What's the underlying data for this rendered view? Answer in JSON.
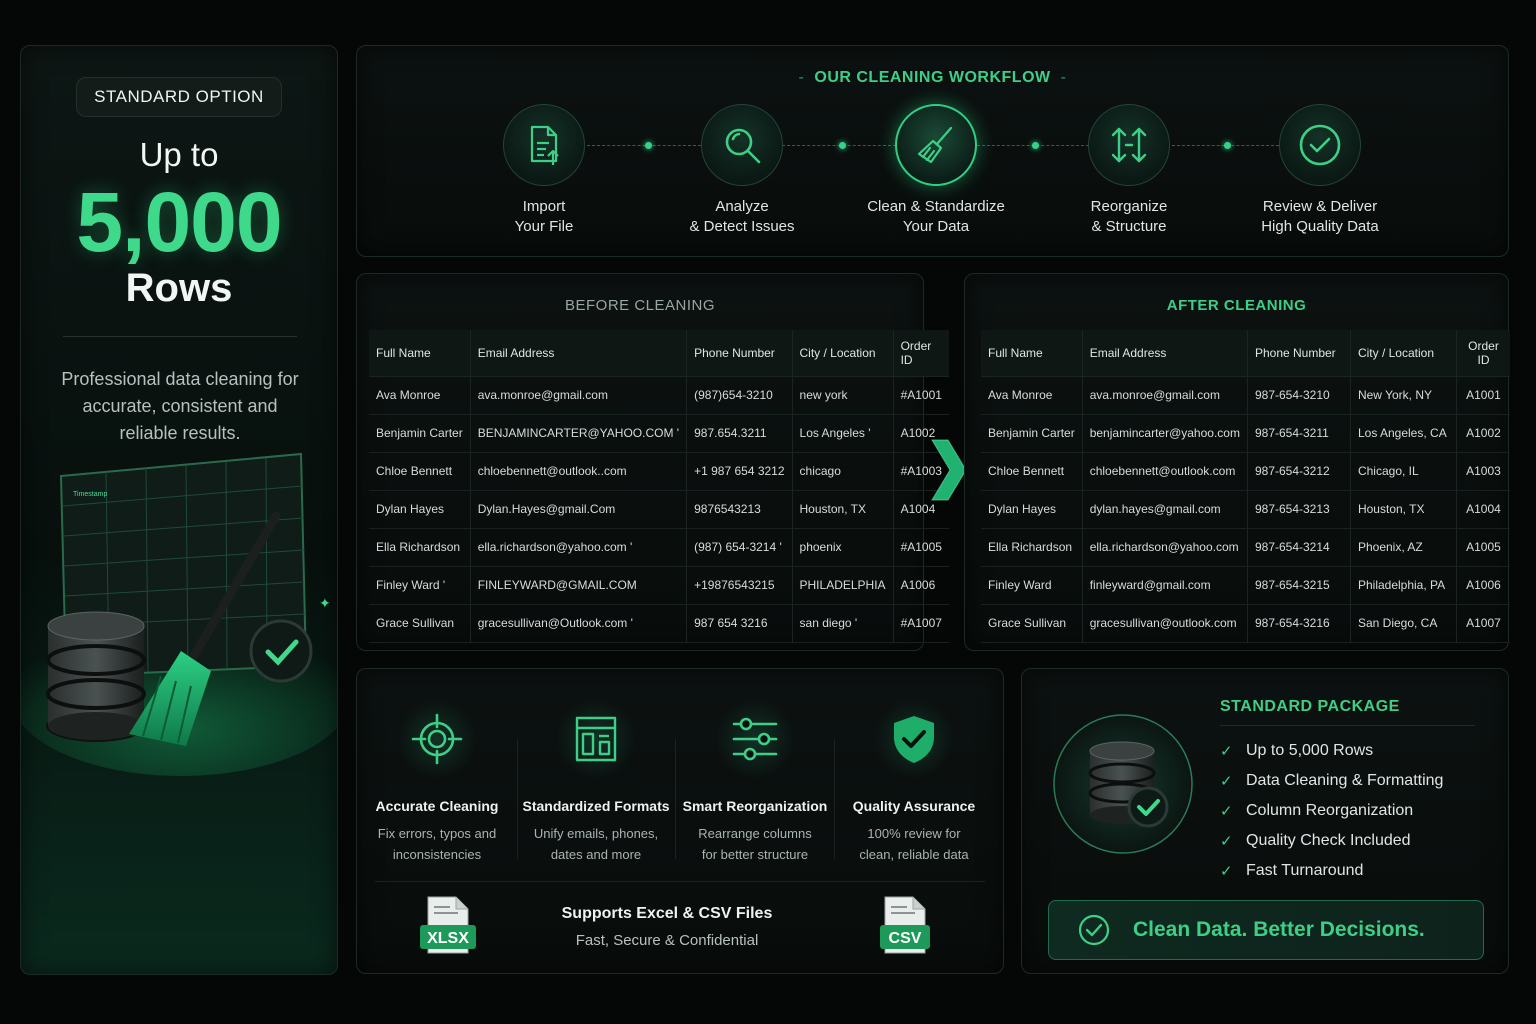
{
  "left": {
    "badge": "STANDARD OPTION",
    "up_to": "Up to",
    "big_number": "5,000",
    "rows_label": "Rows",
    "description": "Professional data cleaning for accurate, consistent and reliable results."
  },
  "workflow": {
    "title": "OUR CLEANING WORKFLOW",
    "steps": [
      {
        "line1": "Import",
        "line2": "Your File",
        "icon": "file-upload-icon"
      },
      {
        "line1": "Analyze",
        "line2": "& Detect Issues",
        "icon": "magnifier-icon"
      },
      {
        "line1": "Clean & Standardize",
        "line2": "Your Data",
        "icon": "broom-icon"
      },
      {
        "line1": "Reorganize",
        "line2": "& Structure",
        "icon": "sort-arrows-icon"
      },
      {
        "line1": "Review & Deliver",
        "line2": "High Quality Data",
        "icon": "check-circle-icon"
      }
    ]
  },
  "before": {
    "title": "BEFORE CLEANING",
    "columns": [
      "Full Name",
      "Email Address",
      "Phone Number",
      "City / Location",
      "Order ID"
    ],
    "rows": [
      [
        "Ava Monroe",
        "ava.monroe@gmail.com",
        "(987)654-3210",
        "new york",
        "#A1001"
      ],
      [
        " Benjamin  Carter",
        "BENJAMINCARTER@YAHOO.COM '",
        " 987.654.3211",
        "Los Angeles '",
        " A1002"
      ],
      [
        "Chloe Bennett",
        "chloebennett@outlook..com",
        "+1 987 654 3212",
        "chicago",
        "#A1003"
      ],
      [
        "Dylan Hayes",
        "Dylan.Hayes@gmail.Com",
        " 9876543213",
        "Houston, TX",
        " A1004"
      ],
      [
        "Ella Richardson",
        "ella.richardson@yahoo.com '",
        "(987) 654-3214 '",
        "phoenix",
        "#A1005"
      ],
      [
        " Finley Ward '",
        "FINLEYWARD@GMAIL.COM",
        "+19876543215",
        "PHILADELPHIA",
        " A1006"
      ],
      [
        "Grace Sullivan",
        "gracesullivan@Outlook.com '",
        " 987 654 3216",
        "san diego '",
        "#A1007"
      ]
    ]
  },
  "after": {
    "title": "AFTER CLEANING",
    "columns": [
      "Full Name",
      "Email Address",
      "Phone Number",
      "City / Location",
      "Order ID"
    ],
    "rows": [
      [
        "Ava Monroe",
        "ava.monroe@gmail.com",
        "987-654-3210",
        "New York, NY",
        "A1001"
      ],
      [
        "Benjamin Carter",
        "benjamincarter@yahoo.com",
        "987-654-3211",
        "Los Angeles, CA",
        "A1002"
      ],
      [
        "Chloe Bennett",
        "chloebennett@outlook.com",
        "987-654-3212",
        "Chicago, IL",
        "A1003"
      ],
      [
        "Dylan Hayes",
        "dylan.hayes@gmail.com",
        "987-654-3213",
        "Houston, TX",
        "A1004"
      ],
      [
        "Ella Richardson",
        "ella.richardson@yahoo.com",
        "987-654-3214",
        "Phoenix, AZ",
        "A1005"
      ],
      [
        "Finley Ward",
        "finleyward@gmail.com",
        "987-654-3215",
        "Philadelphia, PA",
        "A1006"
      ],
      [
        "Grace Sullivan",
        "gracesullivan@outlook.com",
        "987-654-3216",
        "San Diego, CA",
        "A1007"
      ]
    ]
  },
  "features": {
    "items": [
      {
        "title": "Accurate Cleaning",
        "line1": "Fix errors, typos and",
        "line2": "inconsistencies",
        "icon": "target-icon"
      },
      {
        "title": "Standardized Formats",
        "line1": "Unify emails, phones,",
        "line2": "dates and more",
        "icon": "layout-icon"
      },
      {
        "title": "Smart Reorganization",
        "line1": "Rearrange columns",
        "line2": "for better structure",
        "icon": "sliders-icon"
      },
      {
        "title": "Quality Assurance",
        "line1": "100% review for",
        "line2": "clean, reliable data",
        "icon": "shield-check-icon"
      }
    ],
    "supports_title": "Supports Excel & CSV Files",
    "supports_sub": "Fast, Secure & Confidential",
    "xlsx_label": "XLSX",
    "csv_label": "CSV"
  },
  "package": {
    "title": "STANDARD PACKAGE",
    "items": [
      "Up to 5,000 Rows",
      "Data Cleaning & Formatting",
      "Column Reorganization",
      "Quality Check Included",
      "Fast Turnaround"
    ],
    "tagline": "Clean Data. Better Decisions."
  },
  "colors": {
    "accent": "#3ecf86",
    "background": "#050707",
    "panel": "#0c1211"
  }
}
